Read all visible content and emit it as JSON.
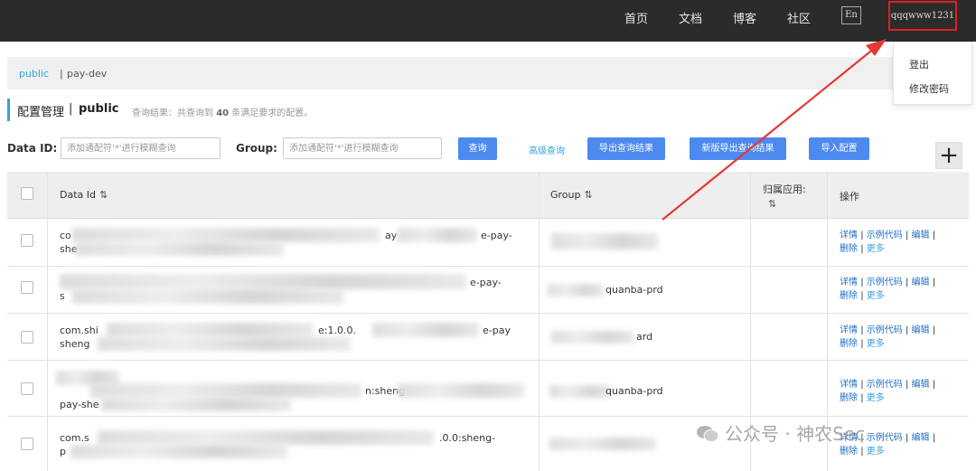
{
  "nav": {
    "items": [
      "首页",
      "文档",
      "博客",
      "社区"
    ],
    "lang": "En",
    "user": "qqqwww1231"
  },
  "user_menu": {
    "logout": "登出",
    "change_password": "修改密码"
  },
  "namespace": {
    "active": "public",
    "sep": "|",
    "other": "pay-dev"
  },
  "page": {
    "title": "配置管理",
    "sep": "|",
    "namespace": "public",
    "result_prefix": "查询结果：共查询到",
    "result_count": "40",
    "result_suffix": "条满足要求的配置。"
  },
  "search": {
    "data_id_label": "Data ID:",
    "data_id_placeholder": "添加通配符'*'进行模糊查询",
    "group_label": "Group:",
    "group_placeholder": "添加通配符'*'进行模糊查询",
    "query": "查询",
    "advanced": "高级查询",
    "export": "导出查询结果",
    "export_new": "新版导出查询结果",
    "import": "导入配置",
    "add": "+"
  },
  "table": {
    "headers": {
      "data_id": "Data Id",
      "group": "Group",
      "app": "归属应用:",
      "ops": "操作"
    },
    "rows": [
      {
        "data_id_l1": "co",
        "data_id_l1b": "ay",
        "data_id_l1c": "e-pay-",
        "data_id_l2": "she",
        "group": ""
      },
      {
        "data_id_l1": "",
        "data_id_l1b": "",
        "data_id_l1c": "e-pay-",
        "data_id_l2": "s",
        "group": "quanba-prd"
      },
      {
        "data_id_l1": "com.shi",
        "data_id_l1b": "e:1.0.0.",
        "data_id_l1c": "e-pay",
        "data_id_l2": "sheng",
        "group": "ard"
      },
      {
        "data_id_l1": "",
        "data_id_l1b": "n:sheng",
        "data_id_l1c": "",
        "data_id_l2": "pay-she",
        "group": "quanba-prd"
      },
      {
        "data_id_l1": "com.s",
        "data_id_l1b": ".0.0:sheng-",
        "data_id_l1c": "",
        "data_id_l2": "p",
        "group": ""
      }
    ],
    "ops": {
      "detail": "详情",
      "sample": "示例代码",
      "edit": "编辑",
      "delete": "删除",
      "more": "更多",
      "sep": "|"
    }
  },
  "watermark": "公众号 · 神农Sec",
  "accent_color": "#33a3dc",
  "primary_button_color": "#4d8af0",
  "highlight_color": "#e02020"
}
